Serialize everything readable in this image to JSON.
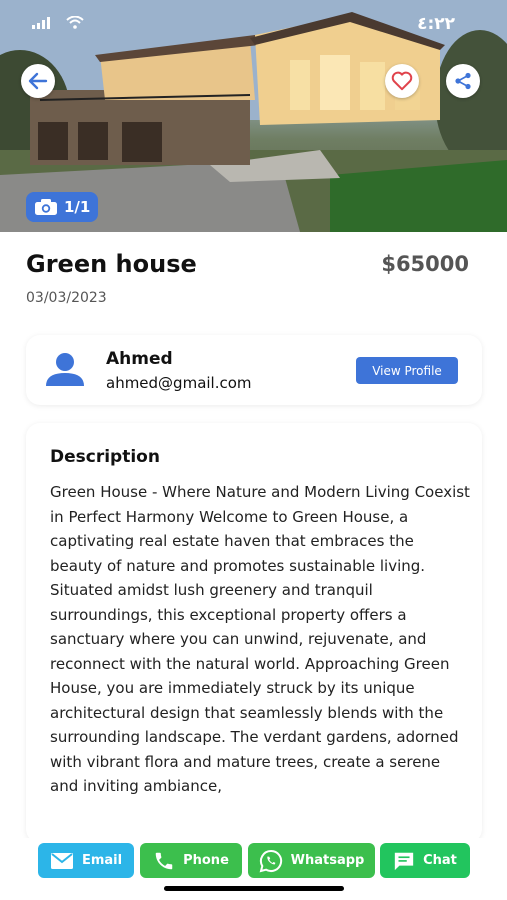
{
  "status_bar": {
    "time": "٤:٢٢",
    "signal_icon": "signal-bars-icon",
    "wifi_icon": "wifi-icon"
  },
  "hero": {
    "photo_counter": "1/1",
    "back_icon": "arrow-left-icon",
    "favorite_icon": "heart-outline-icon",
    "share_icon": "share-icon",
    "camera_icon": "camera-icon"
  },
  "listing": {
    "title": "Green house",
    "price": "$65000",
    "date": "03/03/2023"
  },
  "owner": {
    "name": "Ahmed",
    "email": "ahmed@gmail.com",
    "view_profile_label": "View Profile",
    "avatar_icon": "person-icon"
  },
  "description": {
    "heading": "Description",
    "text": "Green House - Where Nature and Modern Living Coexist in Perfect Harmony Welcome to Green House, a captivating real estate haven that embraces the beauty of nature and promotes sustainable living. Situated amidst lush greenery and tranquil surroundings, this exceptional property offers a sanctuary where you can unwind, rejuvenate, and reconnect with the natural world. Approaching Green House, you are immediately struck by its unique architectural design that seamlessly blends with the surrounding landscape. The verdant gardens, adorned with vibrant flora and mature trees, create a serene and inviting ambiance,"
  },
  "actions": {
    "email_label": "Email",
    "phone_label": "Phone",
    "whatsapp_label": "Whatsapp",
    "chat_label": "Chat"
  },
  "colors": {
    "accent_blue": "#3e74d8",
    "email_blue": "#2cb5e8",
    "green": "#3cbf4d",
    "chat_green": "#22c55e",
    "heart_red": "#e0434c"
  }
}
